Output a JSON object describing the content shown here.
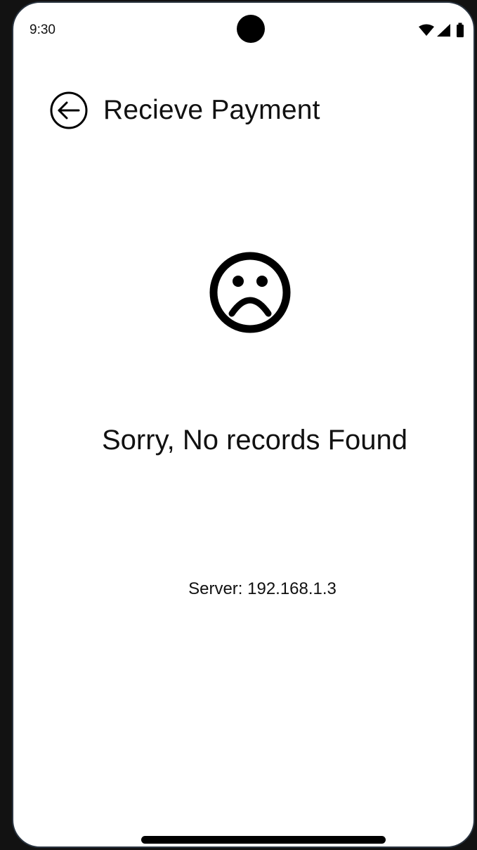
{
  "status_bar": {
    "time": "9:30",
    "icons": [
      "wifi-icon",
      "signal-icon",
      "battery-icon"
    ]
  },
  "header": {
    "back_icon": "back-arrow-circle-icon",
    "title": "Recieve Payment"
  },
  "empty_state": {
    "icon": "sad-face-icon",
    "message": "Sorry, No records Found"
  },
  "server": {
    "label": "Server: 192.168.1.3"
  },
  "colors": {
    "frame": "#121212",
    "screen": "#ffffff",
    "text": "#111111"
  }
}
